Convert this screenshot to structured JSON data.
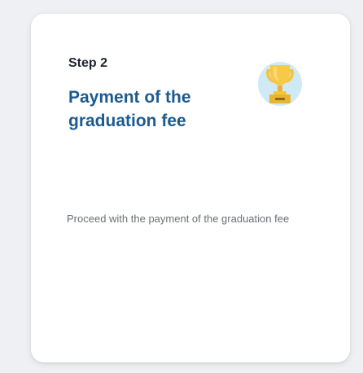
{
  "card": {
    "step": "Step 2",
    "title": "Payment of the graduation fee",
    "description": "Proceed with the payment of the graduation fee",
    "icon": "trophy-icon"
  },
  "colors": {
    "title": "#1d5b8f",
    "step_text": "#1f2430",
    "description_text": "#6b6f76",
    "trophy_gold": "#f5c442",
    "trophy_circle": "#cfe9f5",
    "background": "#eef0f3",
    "card_background": "#ffffff"
  }
}
